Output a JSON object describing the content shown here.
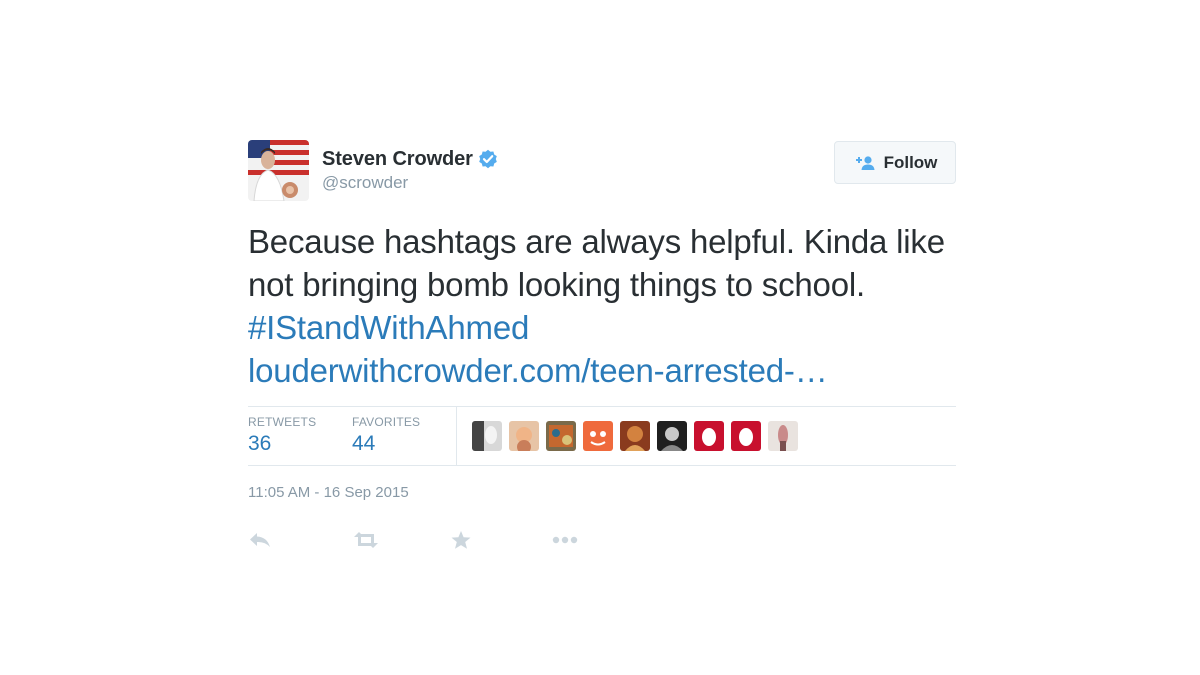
{
  "user": {
    "full_name": "Steven Crowder",
    "screen_name": "@scrowder",
    "verified_icon": "verified-badge-icon"
  },
  "follow_button": {
    "label": "Follow",
    "icon": "add-user-icon"
  },
  "tweet": {
    "text": "Because hashtags are always helpful. Kinda like not bringing bomb looking things to school.",
    "hashtag": "#IStandWithAhmed",
    "link": "louderwithcrowder.com/teen-arrested-…"
  },
  "stats": {
    "retweets_label": "RETWEETS",
    "retweets_count": "36",
    "favorites_label": "FAVORITES",
    "favorites_count": "44"
  },
  "timestamp": "11:05 AM - 16 Sep 2015",
  "actions": [
    "reply-icon",
    "retweet-icon",
    "favorite-icon",
    "more-icon"
  ],
  "colors": {
    "link": "#2b7bb9",
    "muted": "#8899a6",
    "text": "#292f33",
    "verified": "#55acee",
    "border": "#e1e8ed"
  }
}
